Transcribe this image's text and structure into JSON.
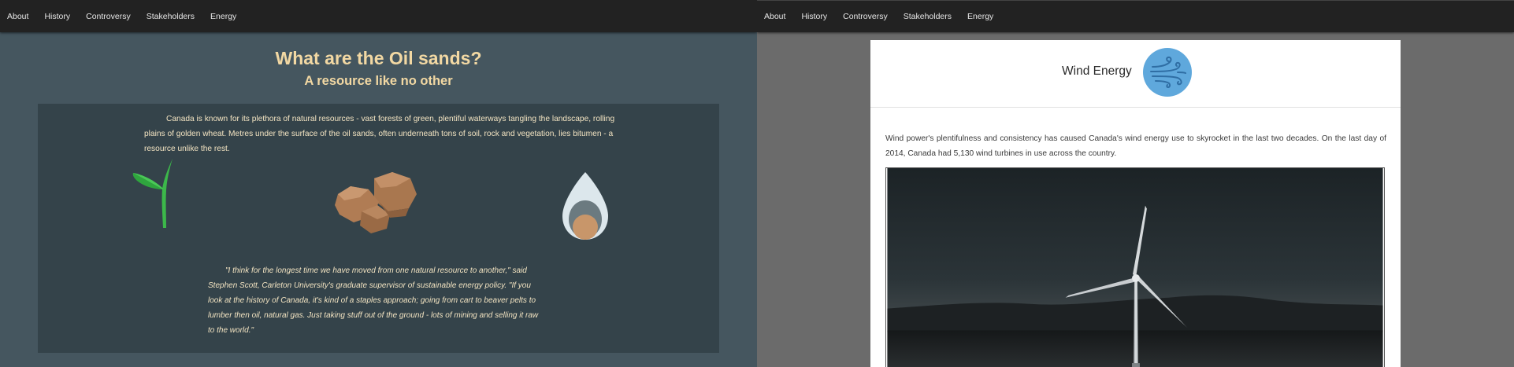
{
  "left_page": {
    "nav": [
      "About",
      "History",
      "Controversy",
      "Stakeholders",
      "Energy"
    ],
    "title": "What are the Oil sands?",
    "subtitle": "A resource like no other",
    "intro": "Canada is known for its plethora of natural resources - vast forests of green, plentiful waterways tangling the landscape, rolling plains of golden wheat. Metres under the surface of the oil sands, often underneath tons of soil, rock and vegetation, lies bitumen - a resource unlike the rest.",
    "quote": "\"I think for the longest time we have moved from one natural resource to another,\" said Stephen Scott, Carleton University's graduate supervisor of sustainable energy policy. \"If you look at the history of Canada, it's kind of a staples approach; going from cart to beaver pelts to lumber then oil, natural gas. Just taking stuff out of the ground - lots of mining and selling it raw to the world.\"",
    "illustrations": [
      "sprout-icon",
      "rocks-icon",
      "oil-drop-icon"
    ]
  },
  "right_page": {
    "nav": [
      "About",
      "History",
      "Controversy",
      "Stakeholders",
      "Energy"
    ],
    "title": "Wind Energy",
    "icon": "wind-icon",
    "paragraph": "Wind power's plentifulness and consistency has caused Canada's wind energy use to skyrocket in the last two decades. On the last day of 2014, Canada had 5,130 wind turbines in use across the country.",
    "photo": "wind-turbine-photo"
  },
  "colors": {
    "navbar": "#222222",
    "left_background": "#45565f",
    "left_card": "#34434a",
    "accent_title": "#f2d8a3",
    "wind_icon_circle": "#5fa8dc",
    "right_background": "#6b6b6b"
  }
}
